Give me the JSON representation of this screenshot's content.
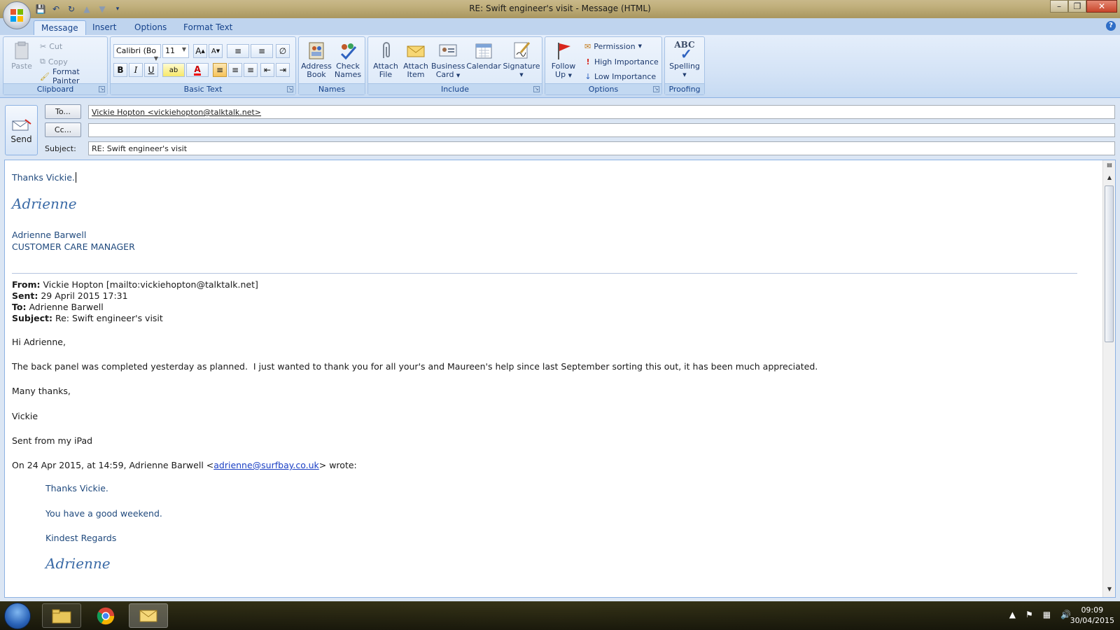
{
  "window": {
    "title": "RE: Swift engineer's visit - Message (HTML)"
  },
  "tabs": [
    {
      "label": "Message",
      "active": true
    },
    {
      "label": "Insert"
    },
    {
      "label": "Options"
    },
    {
      "label": "Format Text"
    }
  ],
  "ribbon": {
    "clipboard": {
      "group_label": "Clipboard",
      "paste": "Paste",
      "cut": "Cut",
      "copy": "Copy",
      "format_painter": "Format Painter"
    },
    "basic_text": {
      "group_label": "Basic Text",
      "font_name": "Calibri (Bo",
      "font_size": "11"
    },
    "names": {
      "group_label": "Names",
      "address_book": [
        "Address",
        "Book"
      ],
      "check_names": [
        "Check",
        "Names"
      ]
    },
    "include": {
      "group_label": "Include",
      "attach_file": [
        "Attach",
        "File"
      ],
      "attach_item": [
        "Attach",
        "Item"
      ],
      "business_card": [
        "Business",
        "Card"
      ],
      "calendar": "Calendar",
      "signature": "Signature"
    },
    "options": {
      "group_label": "Options",
      "follow_up": [
        "Follow",
        "Up"
      ],
      "permission": "Permission",
      "high_importance": "High Importance",
      "low_importance": "Low Importance"
    },
    "proofing": {
      "group_label": "Proofing",
      "spelling": "Spelling",
      "abc": "ABC"
    }
  },
  "compose": {
    "send_label": "Send",
    "to_button": "To...",
    "cc_button": "Cc...",
    "subject_label": "Subject:",
    "to_value": "Vickie Hopton <vickiehopton@talktalk.net>",
    "cc_value": "",
    "subject_value": "RE: Swift engineer's visit"
  },
  "body": {
    "reply_line": "Thanks Vickie.",
    "signature_script": "Adrienne",
    "sender_name": "Adrienne Barwell",
    "sender_title": "CUSTOMER CARE MANAGER",
    "from_label": "From:",
    "from_value": "Vickie Hopton [mailto:vickiehopton@talktalk.net]",
    "sent_label": "Sent:",
    "sent_value": "29 April 2015 17:31",
    "to_label": "To:",
    "to_value": "Adrienne Barwell",
    "subject_label": "Subject:",
    "subject_value": "Re: Swift engineer's visit",
    "greeting": "Hi Adrienne,",
    "paragraph": "The back panel was completed yesterday as planned.  I just wanted to thank you for all your's and Maureen's help since last September sorting this out, it has been much appreciated.",
    "thanks": "Many thanks,",
    "name": "Vickie",
    "sent_from": "Sent from my iPad",
    "quote_intro_before": "On 24 Apr 2015, at 14:59, Adrienne Barwell <",
    "quote_intro_link": "adrienne@surfbay.co.uk",
    "quote_intro_after": "> wrote:",
    "quoted": {
      "line1": "Thanks Vickie.",
      "line2": "You have a good weekend.",
      "line3": "Kindest Regards",
      "signature_script": "Adrienne"
    }
  },
  "taskbar": {
    "time": "09:09",
    "date": "30/04/2015"
  },
  "colors": {
    "body_blue": "#1f497d",
    "link": "#1a3fc4",
    "ribbon_text": "#15428b"
  }
}
